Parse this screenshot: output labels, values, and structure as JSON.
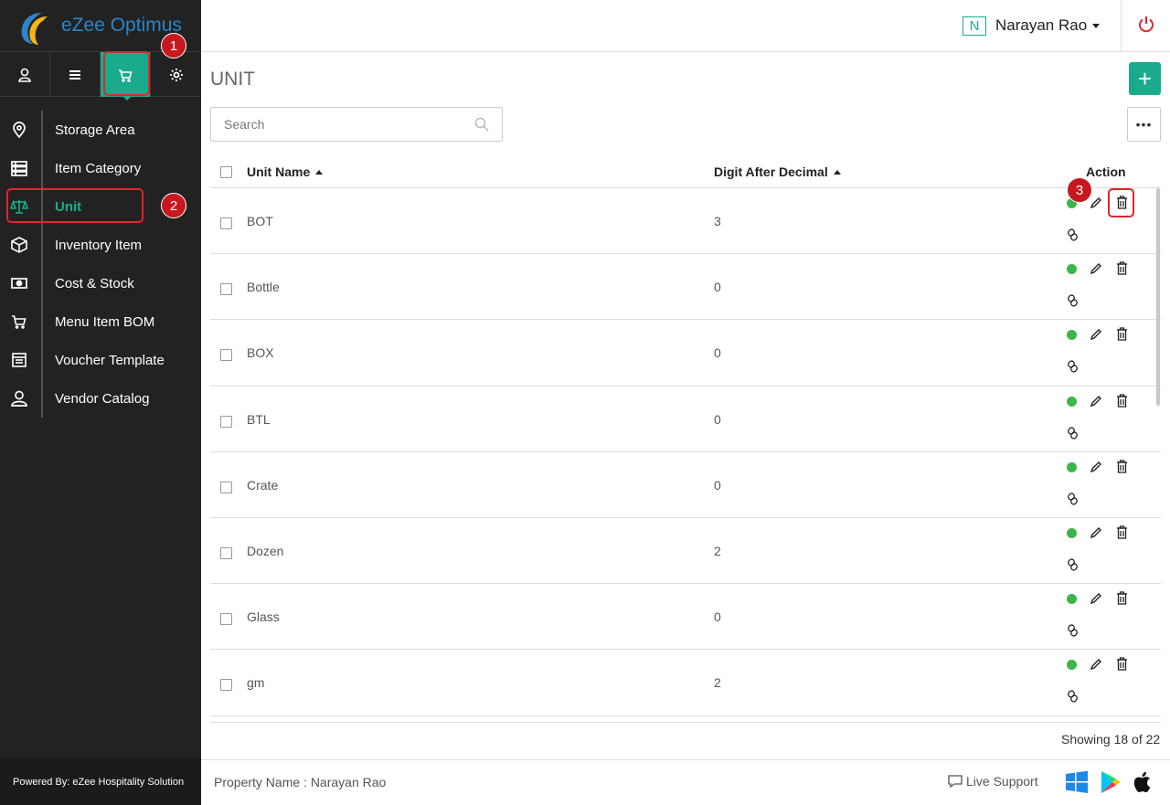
{
  "brand": {
    "name": "eZee Optimus"
  },
  "sidebar": {
    "top_icons": [
      {
        "name": "user-icon"
      },
      {
        "name": "menu-icon"
      },
      {
        "name": "cart-icon",
        "active": true
      },
      {
        "name": "gear-icon"
      }
    ],
    "items": [
      {
        "label": "Storage Area",
        "icon": "location-pin-icon"
      },
      {
        "label": "Item Category",
        "icon": "category-list-icon"
      },
      {
        "label": "Unit",
        "icon": "scale-icon",
        "active": true
      },
      {
        "label": "Inventory Item",
        "icon": "box-icon"
      },
      {
        "label": "Cost & Stock",
        "icon": "money-icon"
      },
      {
        "label": "Menu Item BOM",
        "icon": "cart-icon"
      },
      {
        "label": "Voucher Template",
        "icon": "voucher-icon"
      },
      {
        "label": "Vendor Catalog",
        "icon": "vendor-icon"
      }
    ],
    "footer": "Powered By: eZee Hospitality Solution"
  },
  "header": {
    "user_initial": "N",
    "user_name": "Narayan Rao"
  },
  "page": {
    "title": "UNIT",
    "add_label": "+",
    "more_label": "•••",
    "search_placeholder": "Search"
  },
  "table": {
    "columns": {
      "name": "Unit Name",
      "digits": "Digit After Decimal",
      "action": "Action"
    },
    "rows": [
      {
        "name": "BOT",
        "digits": "3"
      },
      {
        "name": "Bottle",
        "digits": "0"
      },
      {
        "name": "BOX",
        "digits": "0"
      },
      {
        "name": "BTL",
        "digits": "0"
      },
      {
        "name": "Crate",
        "digits": "0"
      },
      {
        "name": "Dozen",
        "digits": "2"
      },
      {
        "name": "Glass",
        "digits": "0"
      },
      {
        "name": "gm",
        "digits": "2"
      }
    ],
    "showing": "Showing 18 of 22"
  },
  "annotations": {
    "one": "1",
    "two": "2",
    "three": "3"
  },
  "footer": {
    "property": "Property Name : Narayan Rao",
    "live_support": "Live Support"
  },
  "colors": {
    "accent": "#1aab8c",
    "sidebar": "#222222",
    "highlight": "#e3242b",
    "status_active": "#3cb54a"
  }
}
